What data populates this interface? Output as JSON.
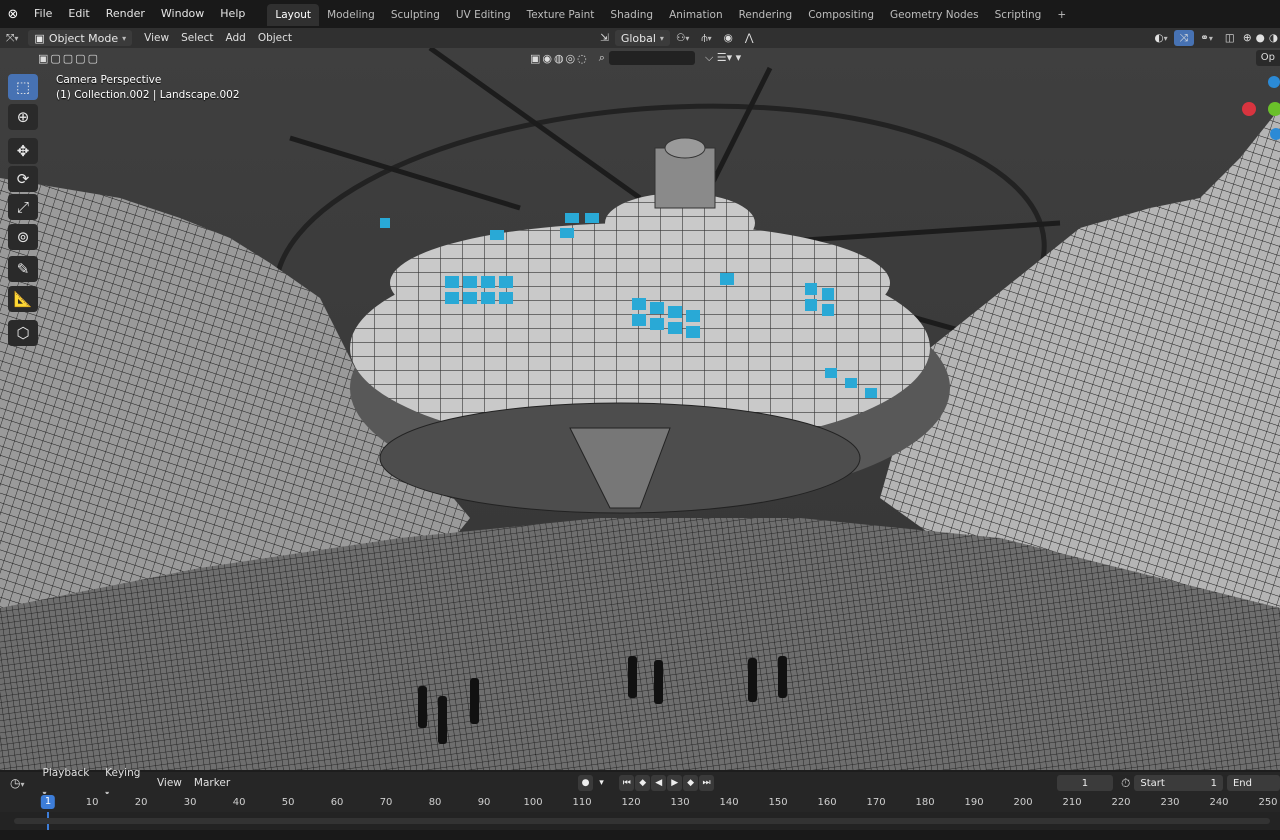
{
  "menu": {
    "items": [
      "File",
      "Edit",
      "Render",
      "Window",
      "Help"
    ]
  },
  "workspaces": {
    "tabs": [
      "Layout",
      "Modeling",
      "Sculpting",
      "UV Editing",
      "Texture Paint",
      "Shading",
      "Animation",
      "Rendering",
      "Compositing",
      "Geometry Nodes",
      "Scripting"
    ],
    "active": "Layout",
    "add_label": "+"
  },
  "header": {
    "mode": "Object Mode",
    "menus": [
      "View",
      "Select",
      "Add",
      "Object"
    ],
    "orientation": "Global",
    "options_label": "Op"
  },
  "viewport": {
    "camera_label": "Camera Perspective",
    "collection_label": "(1) Collection.002 | Landscape.002"
  },
  "timeline": {
    "menus": [
      "Playback",
      "Keying",
      "View",
      "Marker"
    ],
    "current_frame": "1",
    "start_label": "Start",
    "start_value": "1",
    "end_label": "End",
    "ruler_marks": [
      "1",
      "10",
      "20",
      "30",
      "40",
      "50",
      "60",
      "70",
      "80",
      "90",
      "100",
      "110",
      "120",
      "130",
      "140",
      "150",
      "160",
      "170",
      "180",
      "190",
      "200",
      "210",
      "220",
      "230",
      "240",
      "250"
    ]
  },
  "colors": {
    "accent": "#4772b3",
    "frame_marker": "#3d7dd8",
    "viewport_bg": "#3d3d3d"
  }
}
